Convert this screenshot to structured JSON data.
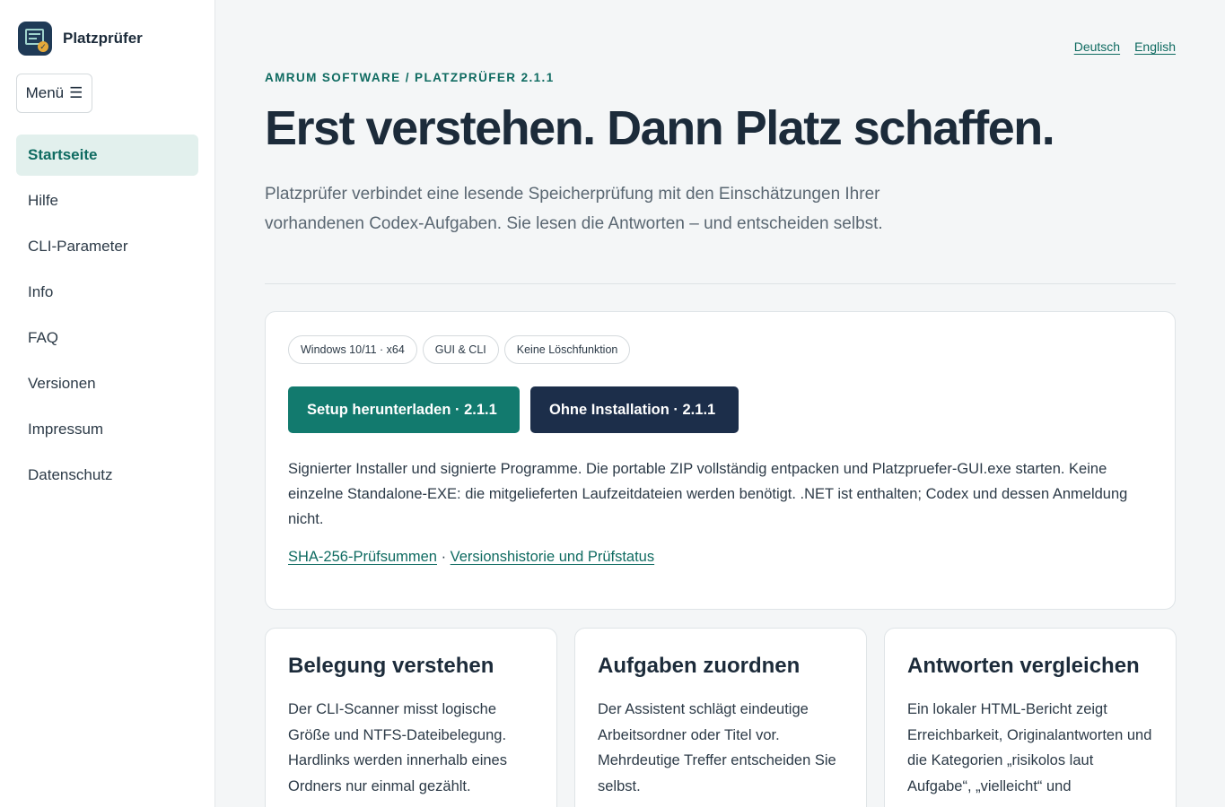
{
  "brand": {
    "name": "Platzprüfer",
    "icon": "report-check-icon"
  },
  "menu": {
    "label": "Menü",
    "icon": "hamburger-icon"
  },
  "nav": {
    "items": [
      {
        "label": "Startseite",
        "active": true
      },
      {
        "label": "Hilfe"
      },
      {
        "label": "CLI-Parameter"
      },
      {
        "label": "Info"
      },
      {
        "label": "FAQ"
      },
      {
        "label": "Versionen"
      },
      {
        "label": "Impressum"
      },
      {
        "label": "Datenschutz"
      }
    ]
  },
  "lang": {
    "de": "Deutsch",
    "en": "English"
  },
  "hero": {
    "eyebrow": "AMRUM SOFTWARE / PLATZPRÜFER 2.1.1",
    "title": "Erst verstehen. Dann Platz schaffen.",
    "subtitle": "Platzprüfer verbindet eine lesende Speicherprüfung mit den Einschätzungen Ihrer vorhandenen Codex-Aufgaben. Sie lesen die Antworten – und entscheiden selbst."
  },
  "download": {
    "chips": [
      "Windows 10/11 · x64",
      "GUI & CLI",
      "Keine Löschfunktion"
    ],
    "setup_button": "Setup herunterladen · 2.1.1",
    "portable_button": "Ohne Installation · 2.1.1",
    "description": "Signierter Installer und signierte Programme. Die portable ZIP vollständig entpacken und Platzpruefer-GUI.exe starten. Keine einzelne Standalone-EXE: die mitgelieferten Laufzeitdateien werden benötigt. .NET ist enthalten; Codex und dessen Anmeldung nicht.",
    "link_checksums": "SHA-256-Prüfsummen",
    "separator": " · ",
    "link_history": "Versionshistorie und Prüfstatus"
  },
  "features": [
    {
      "title": "Belegung verstehen",
      "text": "Der CLI-Scanner misst logische Größe und NTFS-Dateibelegung. Hardlinks werden innerhalb eines Ordners nur einmal gezählt."
    },
    {
      "title": "Aufgaben zuordnen",
      "text": "Der Assistent schlägt eindeutige Arbeitsordner oder Titel vor. Mehrdeutige Treffer entscheiden Sie selbst."
    },
    {
      "title": "Antworten vergleichen",
      "text": "Ein lokaler HTML-Bericht zeigt Erreichbarkeit, Originalantworten und die Kategorien „risikolos laut Aufgabe“, „vielleicht“ und"
    }
  ],
  "colors": {
    "accent": "#0f6b61",
    "primary_button": "#127a6e",
    "secondary_button": "#1c2e4a",
    "heading": "#1c2b3a",
    "background": "#f4f6f7"
  }
}
